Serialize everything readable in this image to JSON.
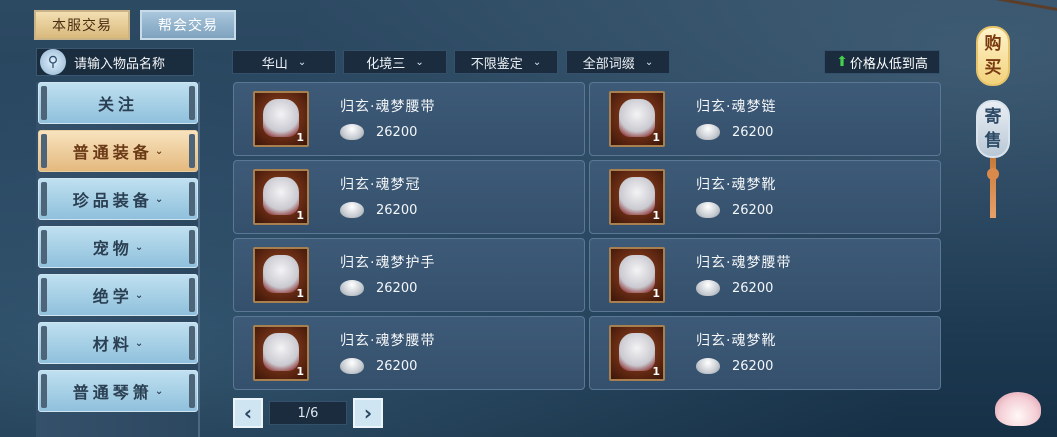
{
  "top_tabs": {
    "server": "本服交易",
    "guild": "帮会交易"
  },
  "search": {
    "placeholder": "请输入物品名称"
  },
  "sidebar": [
    {
      "label": "关注",
      "has_arrow": false,
      "active": false
    },
    {
      "label": "普通装备",
      "has_arrow": true,
      "active": true
    },
    {
      "label": "珍品装备",
      "has_arrow": true,
      "active": false
    },
    {
      "label": "宠物",
      "has_arrow": true,
      "active": false
    },
    {
      "label": "绝学",
      "has_arrow": true,
      "active": false
    },
    {
      "label": "材料",
      "has_arrow": true,
      "active": false
    },
    {
      "label": "普通琴箫",
      "has_arrow": true,
      "active": false
    }
  ],
  "filters": {
    "sect": "华山",
    "realm": "化境三",
    "identify": "不限鉴定",
    "affix": "全部词缀",
    "dropdown_glyph": "⌄"
  },
  "sort": {
    "arrow": "⬆",
    "label": "价格从低到高"
  },
  "items": [
    {
      "name": "归玄·魂梦腰带",
      "price": "26200",
      "qty": "1",
      "icon": "waist-belt-icon"
    },
    {
      "name": "归玄·魂梦链",
      "price": "26200",
      "qty": "1",
      "icon": "necklace-icon"
    },
    {
      "name": "归玄·魂梦冠",
      "price": "26200",
      "qty": "1",
      "icon": "crown-icon"
    },
    {
      "name": "归玄·魂梦靴",
      "price": "26200",
      "qty": "1",
      "icon": "boots-icon"
    },
    {
      "name": "归玄·魂梦护手",
      "price": "26200",
      "qty": "1",
      "icon": "gauntlet-icon"
    },
    {
      "name": "归玄·魂梦腰带",
      "price": "26200",
      "qty": "1",
      "icon": "waist-belt-icon"
    },
    {
      "name": "归玄·魂梦腰带",
      "price": "26200",
      "qty": "1",
      "icon": "waist-belt-icon"
    },
    {
      "name": "归玄·魂梦靴",
      "price": "26200",
      "qty": "1",
      "icon": "boots-icon"
    }
  ],
  "pager": {
    "prev": "‹",
    "page": "1/6",
    "next": "›"
  },
  "lanterns": {
    "buy": [
      "购",
      "买"
    ],
    "sell": [
      "寄",
      "售"
    ]
  },
  "colors": {
    "active_tab": "#e4b97e",
    "inactive_tab": "#8fc0dc",
    "accent_arrow": "#44d04a"
  }
}
